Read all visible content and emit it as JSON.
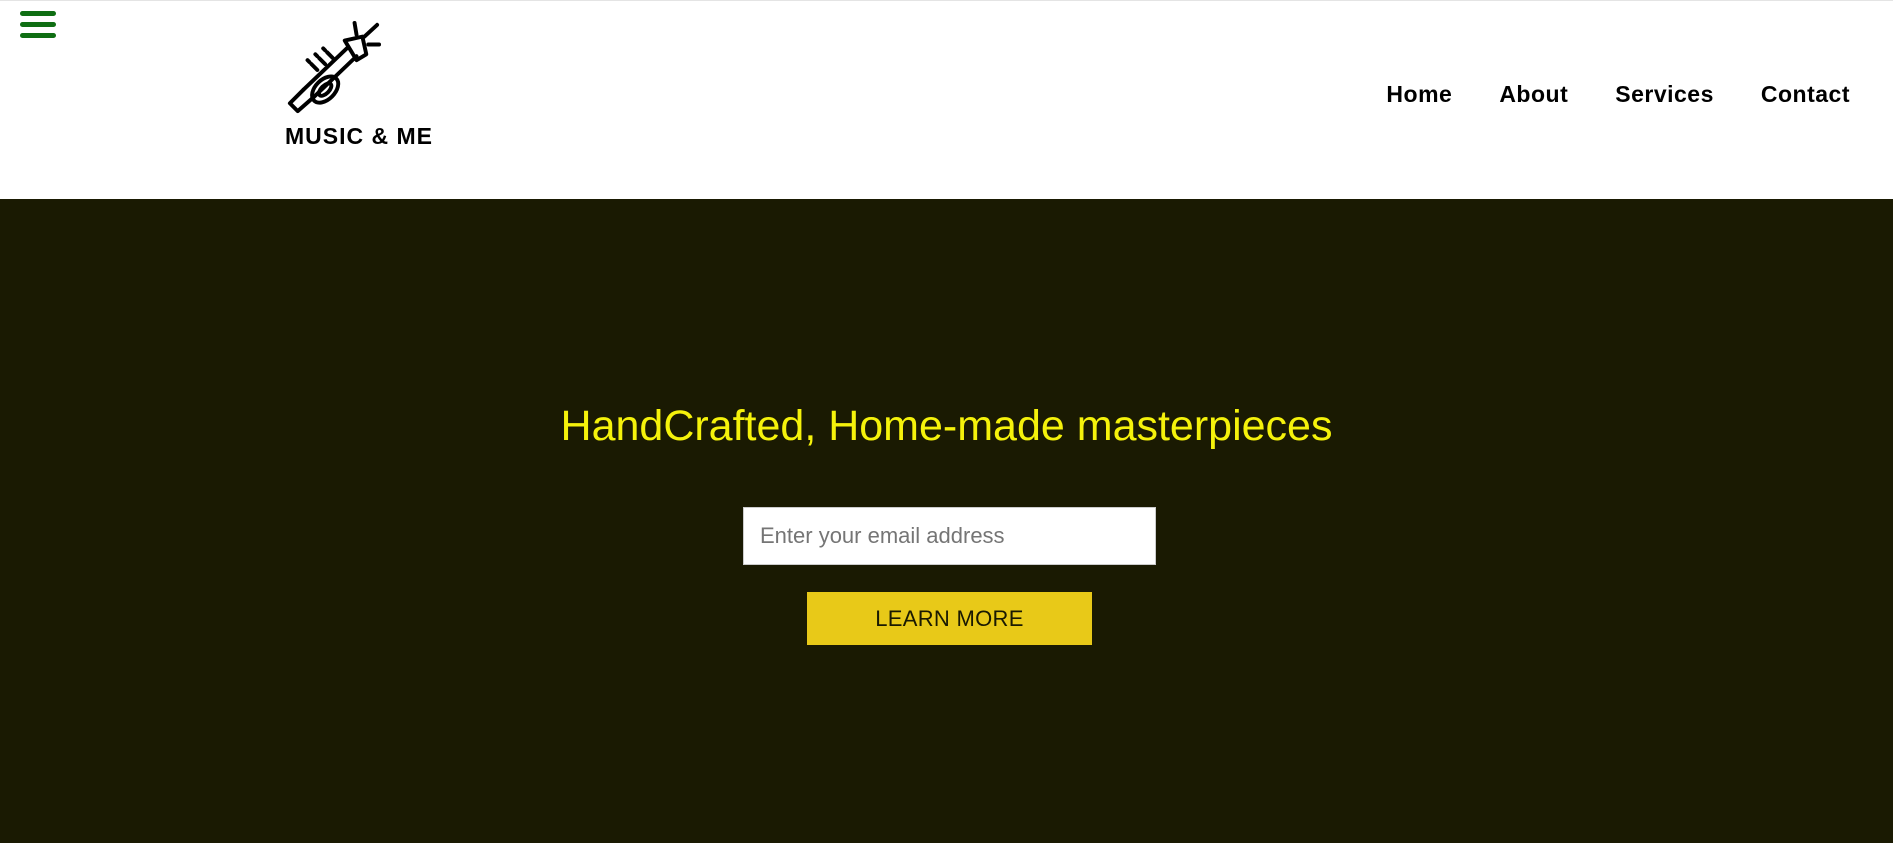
{
  "header": {
    "menu_icon": "hamburger-menu-icon",
    "logo_icon": "trumpet-icon",
    "brand": "MUSIC & ME",
    "nav": [
      {
        "label": "Home"
      },
      {
        "label": "About"
      },
      {
        "label": "Services"
      },
      {
        "label": "Contact"
      }
    ]
  },
  "hero": {
    "title": "HandCrafted, Home-made masterpieces",
    "email_placeholder": "Enter your email address",
    "email_value": "",
    "cta_label": "LEARN MORE"
  },
  "colors": {
    "menu_icon": "#0f6e13",
    "hero_background": "#1a1a02",
    "hero_title": "#f5f20b",
    "cta_background": "#e8c918",
    "header_background": "#ffffff",
    "nav_text": "#000000"
  }
}
